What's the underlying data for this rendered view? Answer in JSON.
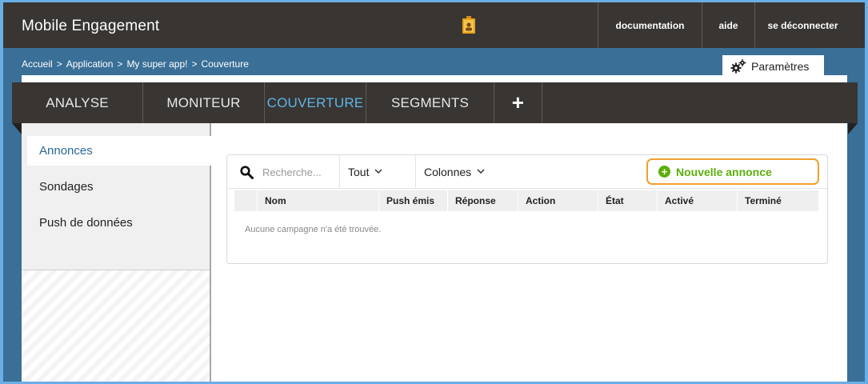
{
  "header": {
    "app_title": "Mobile Engagement",
    "links": [
      "documentation",
      "aide",
      "se déconnecter"
    ]
  },
  "breadcrumb": {
    "items": [
      "Accueil",
      "Application",
      "My super app!",
      "Couverture"
    ],
    "separator": ">"
  },
  "settings": {
    "label": "Paramètres"
  },
  "nav": {
    "tabs": [
      "ANALYSE",
      "MONITEUR",
      "COUVERTURE",
      "SEGMENTS"
    ],
    "active": "COUVERTURE",
    "add_label": "+"
  },
  "sidebar": {
    "items": [
      "Annonces",
      "Sondages",
      "Push de données"
    ],
    "active": "Annonces"
  },
  "toolbar": {
    "search_placeholder": "Recherche...",
    "filter_value": "Tout",
    "columns_label": "Colonnes",
    "new_button_label": "Nouvelle annonce"
  },
  "table": {
    "columns": [
      "Nom",
      "Push émis",
      "Réponse",
      "Action",
      "État",
      "Activé",
      "Terminé"
    ],
    "rows": [],
    "empty_message": "Aucune campagne n'a été trouvée."
  },
  "colors": {
    "frame_bg": "#3a6f97",
    "topbar_bg": "#383533",
    "active_tab": "#5fb6e6",
    "new_button_text": "#5cae0c",
    "new_button_border": "#f0a030"
  }
}
